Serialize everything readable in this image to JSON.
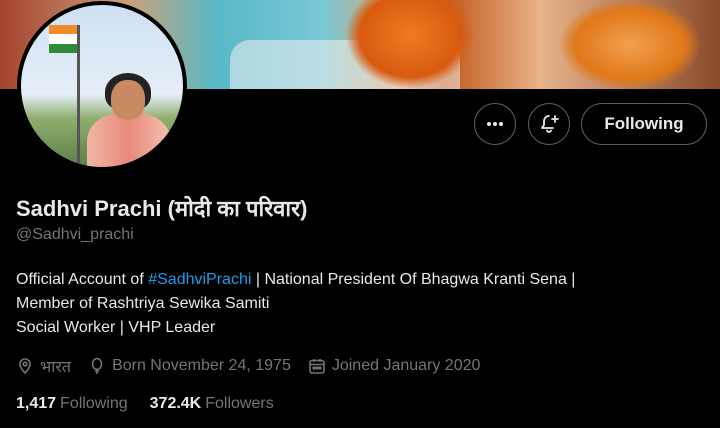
{
  "profile": {
    "display_name": "Sadhvi Prachi (मोदी का परिवार)",
    "handle": "@Sadhvi_prachi",
    "bio": {
      "line1_prefix": "Official Account of ",
      "line1_hashtag": "#SadhviPrachi",
      "line1_suffix": " | National President Of Bhagwa Kranti Sena |",
      "line2": "Member of Rashtriya Sewika Samiti",
      "line3": "Social Worker | VHP Leader"
    },
    "location": "भारत",
    "birthday": "Born November 24, 1975",
    "joined": "Joined January 2020",
    "following_count": "1,417",
    "following_label": "Following",
    "followers_count": "372.4K",
    "followers_label": "Followers"
  },
  "actions": {
    "more_icon": "more-icon",
    "notify_icon": "bell-plus-icon",
    "follow_label": "Following"
  },
  "colors": {
    "background": "#000000",
    "text_primary": "#e7e9ea",
    "text_secondary": "#71767b",
    "link": "#1d9bf0",
    "border": "#536471"
  }
}
